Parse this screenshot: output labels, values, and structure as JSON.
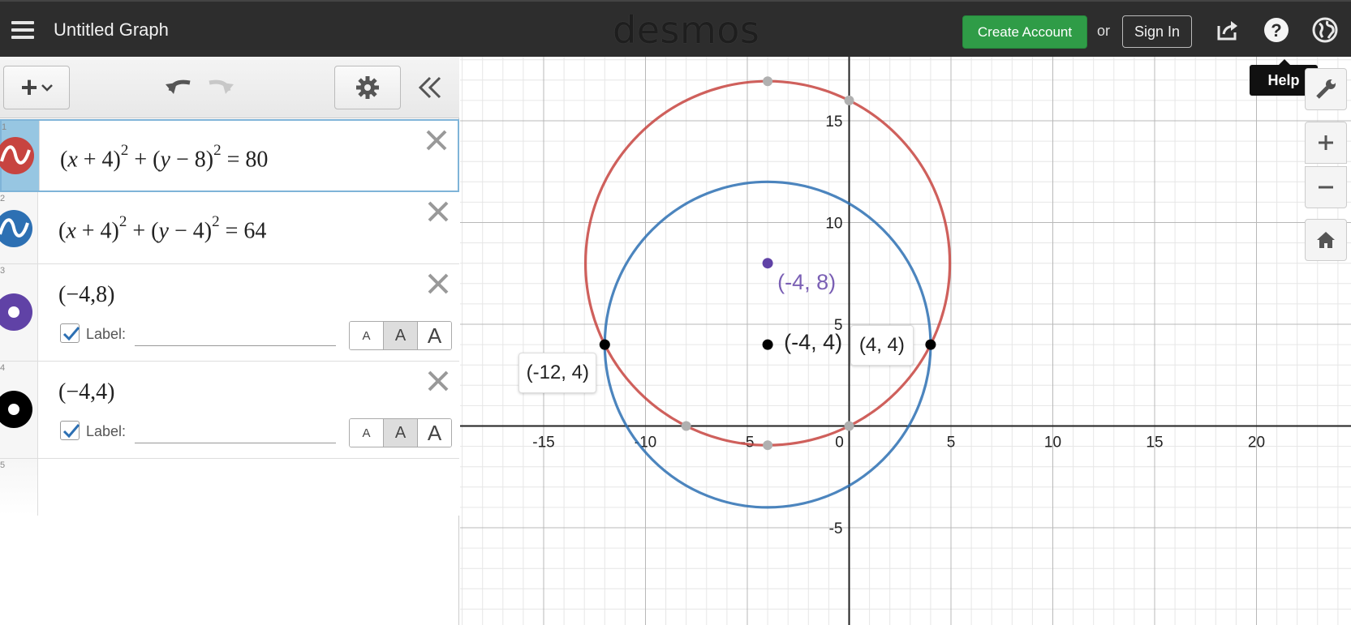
{
  "header": {
    "graph_title": "Untitled Graph",
    "logo": "desmos",
    "create_account": "Create Account",
    "or": "or",
    "sign_in": "Sign In",
    "icons": [
      "menu-icon",
      "share-icon",
      "help-icon",
      "language-globe-icon"
    ]
  },
  "tooltip": {
    "help": "Help"
  },
  "toolbar": {
    "add_label": "+",
    "icons": [
      "add-expression-icon",
      "undo-icon",
      "redo-icon",
      "settings-gear-icon",
      "collapse-panel-icon"
    ]
  },
  "expressions": [
    {
      "index": "1",
      "latex": "(x + 4)^2 + (y − 8)^2 = 80",
      "color": "#c74440",
      "kind": "curve"
    },
    {
      "index": "2",
      "latex": "(x + 4)^2 + (y − 4)^2 = 64",
      "color": "#2d70b3",
      "kind": "curve"
    },
    {
      "index": "3",
      "latex": "(−4,8)",
      "color": "#6042a6",
      "kind": "point",
      "label_text": "Label:",
      "label_checked": true
    },
    {
      "index": "4",
      "latex": "(−4,4)",
      "color": "#000000",
      "kind": "point",
      "label_text": "Label:",
      "label_checked": true
    },
    {
      "index": "5",
      "latex": "",
      "kind": "empty"
    }
  ],
  "text_size_options": [
    "A",
    "A",
    "A"
  ],
  "graph": {
    "x_ticks": [
      "-15",
      "-10",
      "-5",
      "0",
      "5",
      "10",
      "15",
      "20"
    ],
    "y_ticks": [
      "15",
      "10",
      "5",
      "-5"
    ],
    "point_labels": {
      "purple": "(-4, 8)",
      "black": "(-4, 4)",
      "left_intersection": "(-12, 4)",
      "right_intersection": "(4, 4)"
    }
  },
  "controls": [
    "wrench-icon",
    "zoom-in-icon",
    "zoom-out-icon",
    "home-icon"
  ],
  "chart_data": {
    "type": "scatter",
    "xlim": [
      -18,
      25
    ],
    "ylim": [
      -8,
      18
    ],
    "grid": true,
    "curves": [
      {
        "type": "circle",
        "center": [
          -4,
          8
        ],
        "radius_squared": 80,
        "color": "#c74440"
      },
      {
        "type": "circle",
        "center": [
          -4,
          4
        ],
        "radius_squared": 64,
        "color": "#2d70b3"
      }
    ],
    "points": [
      {
        "x": -4,
        "y": 8,
        "color": "#6042a6",
        "label": "(-4, 8)"
      },
      {
        "x": -4,
        "y": 4,
        "color": "#000000",
        "label": "(-4, 4)"
      },
      {
        "x": -12,
        "y": 4,
        "color": "#000000",
        "label": "(-12, 4)"
      },
      {
        "x": 4,
        "y": 4,
        "color": "#000000",
        "label": "(4, 4)"
      }
    ],
    "gray_points": [
      {
        "x": -4,
        "y": 16.944
      },
      {
        "x": 0,
        "y": 16
      },
      {
        "x": -8,
        "y": 0
      },
      {
        "x": 0,
        "y": 0
      },
      {
        "x": -4,
        "y": -0.944
      }
    ]
  }
}
